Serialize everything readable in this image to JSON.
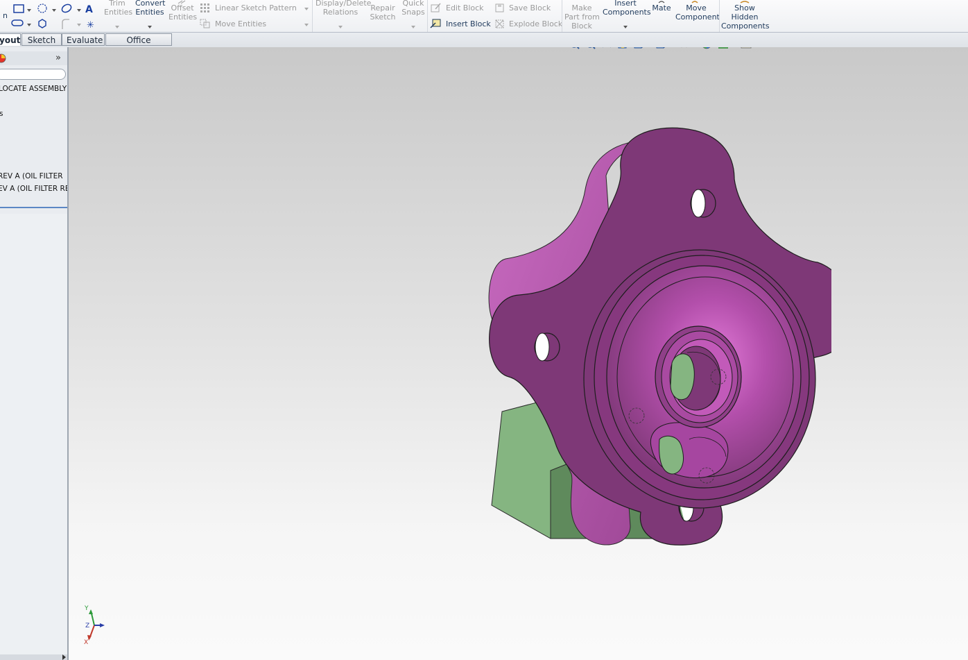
{
  "ribbon": {
    "trim": "Trim\nEntities",
    "convert": "Convert\nEntities",
    "offset": "Offset\nEntities",
    "linear_pattern": "Linear Sketch Pattern",
    "move_entities": "Move Entities",
    "display_delete": "Display/Delete\nRelations",
    "repair": "Repair\nSketch",
    "quick_snaps": "Quick\nSnaps",
    "edit_block": "Edit Block",
    "insert_block": "Insert Block",
    "save_block": "Save Block",
    "explode_block": "Explode Block",
    "make_part": "Make\nPart from\nBlock",
    "insert_components": "Insert\nComponents",
    "mate": "Mate",
    "move_component": "Move\nComponent",
    "show_hidden": "Show\nHidden\nComponents"
  },
  "tabs": [
    {
      "label": "yout",
      "active": true
    },
    {
      "label": "Sketch",
      "active": false
    },
    {
      "label": "Evaluate",
      "active": false
    },
    {
      "label": "Office Products",
      "active": false
    }
  ],
  "tree": {
    "items": [
      "LOCATE ASSEMBLY",
      "s",
      "REV A (OIL FILTER",
      "EV A (OIL FILTER RE"
    ]
  },
  "triad": {
    "x": "X",
    "y": "Y",
    "z": "Z"
  },
  "colors": {
    "part_purple": "#7e3877",
    "part_highlight": "#c05ab8",
    "part_green": "#85b581",
    "part_green_dark": "#5f8a5c",
    "accent_blue": "#5b87c5"
  }
}
